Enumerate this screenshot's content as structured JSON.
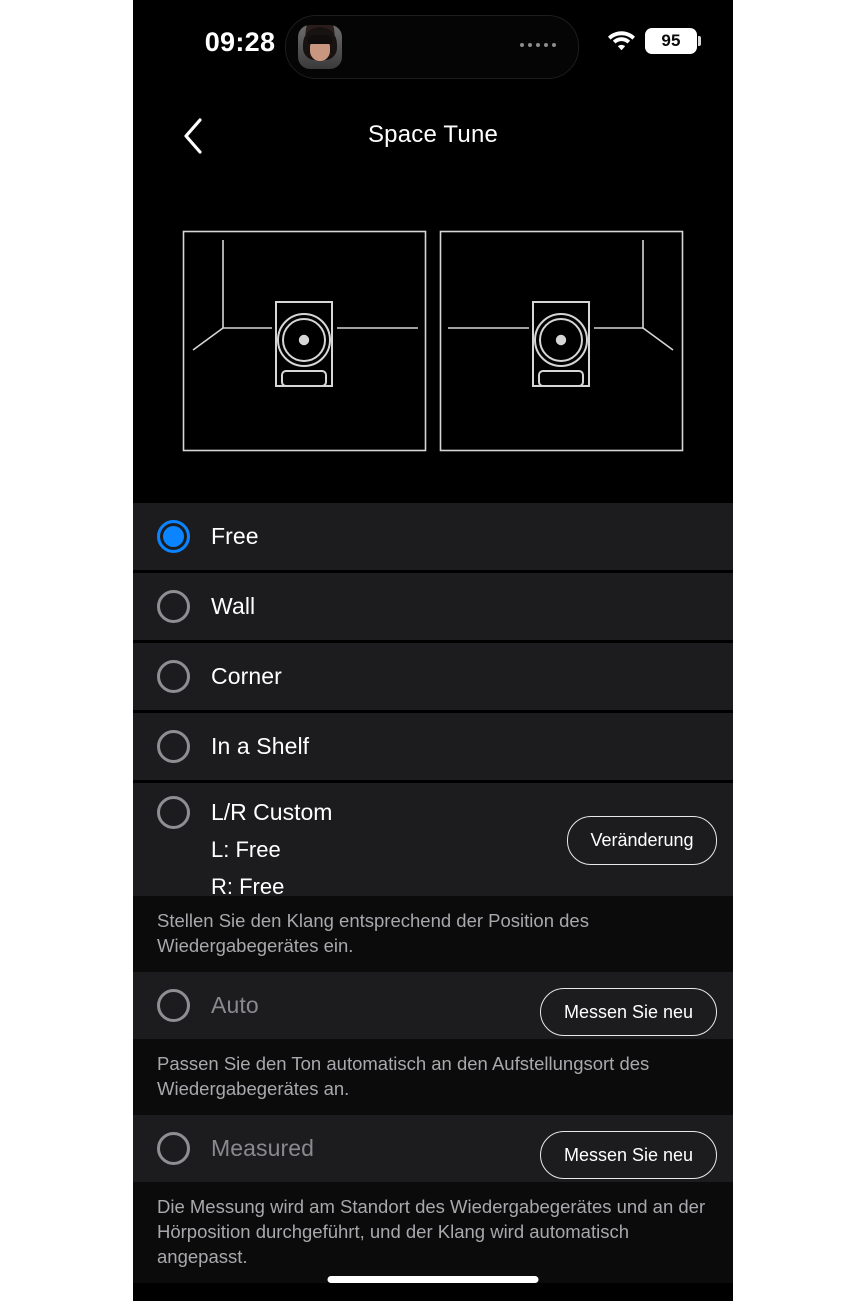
{
  "status_bar": {
    "time": "09:28",
    "wifi_icon": "wifi-icon",
    "battery_level": "95",
    "island_avatar": "avatar",
    "island_activity_icon": "waveform-dots-icon"
  },
  "nav": {
    "back_icon": "chevron-left-icon",
    "title": "Space Tune"
  },
  "diagrams": [
    {
      "name": "room-diagram-left",
      "speaker_position": "left-corner-mirrored"
    },
    {
      "name": "room-diagram-right",
      "speaker_position": "right-corner-mirrored"
    }
  ],
  "options": [
    {
      "id": "free",
      "label": "Free",
      "selected": true,
      "disabled": false
    },
    {
      "id": "wall",
      "label": "Wall",
      "selected": false,
      "disabled": false
    },
    {
      "id": "corner",
      "label": "Corner",
      "selected": false,
      "disabled": false
    },
    {
      "id": "shelf",
      "label": "In a Shelf",
      "selected": false,
      "disabled": false
    }
  ],
  "lr_custom": {
    "label": "L/R Custom",
    "left_value": "L: Free",
    "right_value": "R: Free",
    "button_label": "Veränderung",
    "description": "Stellen Sie den Klang entsprechend der Position des Wiedergabegerätes ein."
  },
  "auto": {
    "label": "Auto",
    "button_label": "Messen Sie neu",
    "description": "Passen Sie den Ton automatisch an den Aufstellungsort des Wiedergabegerätes an."
  },
  "measured": {
    "label": "Measured",
    "button_label": "Messen Sie neu",
    "description": "Die Messung wird am Standort des Wiedergabegerätes und an der Hörposition durchgeführt, und der Klang wird automatisch angepasst."
  },
  "colors": {
    "accent_blue": "#0a84ff",
    "row_background": "#1c1c1e",
    "screen_background": "#000000",
    "secondary_text": "#a8a8ad",
    "disabled_text": "#8a8a8e"
  }
}
